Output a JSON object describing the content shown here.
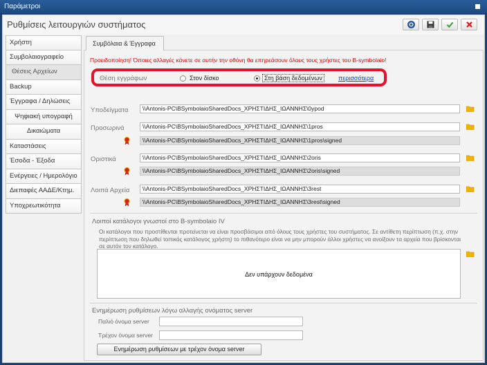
{
  "window": {
    "title": "Παράμετροι"
  },
  "header": {
    "title": "Ρυθμίσεις λειτουργιών συστήματος"
  },
  "sidebar": {
    "items": [
      {
        "label": "Χρήστη"
      },
      {
        "label": "Συμβολαιογραφείο"
      },
      {
        "label": "Θέσεις Αρχείων"
      },
      {
        "label": "Backup"
      },
      {
        "label": "Έγγραφα / Δηλώσεις"
      },
      {
        "label": "Ψηφιακή υπογραφή"
      },
      {
        "label": "Δικαιώματα"
      },
      {
        "label": "Καταστάσεις"
      },
      {
        "label": "Έσοδα - Έξοδα"
      },
      {
        "label": "Ενέργειες / Ημερολόγιο"
      },
      {
        "label": "Διεπαφές ΑΑΔΕ/Κτημ."
      },
      {
        "label": "Υποχρεωτικότητα"
      }
    ]
  },
  "tab": {
    "label": "Συμβόλαια & Έγγραφα"
  },
  "warning": "Προειδοποίηση! Όποιες αλλαγές κάνετε σε αυτήν την οθόνη θα επηρεάσουν όλους τους χρήστες του B-symbolaio!",
  "storage": {
    "label": "Θέση εγγράφων",
    "option_disk": "Στον δίσκο",
    "option_db": "Στη βάση δεδομένων",
    "selected": "Στη βάση δεδομένων",
    "more_link": "περισσότερα"
  },
  "paths": {
    "templates": {
      "label": "Υποδείγματα",
      "value": "\\\\Antonis-PC\\BSymbolaioSharedDocs_ΧΡΗΣΤΙΔΗΣ_ΙΩΑΝΝΗΣ\\0ypod"
    },
    "drafts": {
      "label": "Προσωρινά",
      "value": "\\\\Antonis-PC\\BSymbolaioSharedDocs_ΧΡΗΣΤΙΔΗΣ_ΙΩΑΝΝΗΣ\\1pros",
      "signed": "\\\\Antonis-PC\\BSymbolaioSharedDocs_ΧΡΗΣΤΙΔΗΣ_ΙΩΑΝΝΗΣ\\1pros\\signed"
    },
    "finals": {
      "label": "Οριστικά",
      "value": "\\\\Antonis-PC\\BSymbolaioSharedDocs_ΧΡΗΣΤΙΔΗΣ_ΙΩΑΝΝΗΣ\\2oris",
      "signed": "\\\\Antonis-PC\\BSymbolaioSharedDocs_ΧΡΗΣΤΙΔΗΣ_ΙΩΑΝΝΗΣ\\2oris\\signed"
    },
    "other": {
      "label": "Λοιπά Αρχεία",
      "value": "\\\\Antonis-PC\\BSymbolaioSharedDocs_ΧΡΗΣΤΙΔΗΣ_ΙΩΑΝΝΗΣ\\3rest",
      "signed": "\\\\Antonis-PC\\BSymbolaioSharedDocs_ΧΡΗΣΤΙΔΗΣ_ΙΩΑΝΝΗΣ\\3rest\\signed"
    }
  },
  "known_dirs": {
    "title": "Λοιποί κατάλογοι γνωστοί στο B-symbolaio IV",
    "description": "Οι κατάλογοι που προστίθενται προτείνεται να είναι προσβάσιμοι από όλους τους χρήστες του συστήματος. Σε αντίθετη περίπτωση (π.χ. στην περίπτωση που δηλωθεί τοπικός κατάλογος χρήστη) το πιθανότερο είναι να μην μπορούν άλλοι χρήστες να ανοίξουν τα αρχεία που βρίσκονται σε αυτόν τον κατάλογο.",
    "empty_text": "Δεν υπάρχουν δεδομένα"
  },
  "server_rename": {
    "title": "Ενημέρωση ρυθμίσεων λόγω αλλαγής ονόματος server",
    "old_label": "Παλιό όνομα server",
    "old_value": "",
    "current_label": "Τρέχον όνομα server",
    "current_value": "",
    "button": "Ενημέρωση ρυθμίσεων με τρέχον όνομα server"
  },
  "icons": {
    "help": "help-icon",
    "save": "save-icon",
    "ok": "check-icon",
    "cancel": "close-icon",
    "folder": "folder-icon",
    "signed": "ribbon-icon"
  },
  "colors": {
    "titlebar": "#1f4a82",
    "warning": "#e00000",
    "highlight": "#e2132a",
    "link": "#0645d4",
    "folder": "#f0b400",
    "ok": "#3a9a3a",
    "cancel": "#cc2222"
  }
}
